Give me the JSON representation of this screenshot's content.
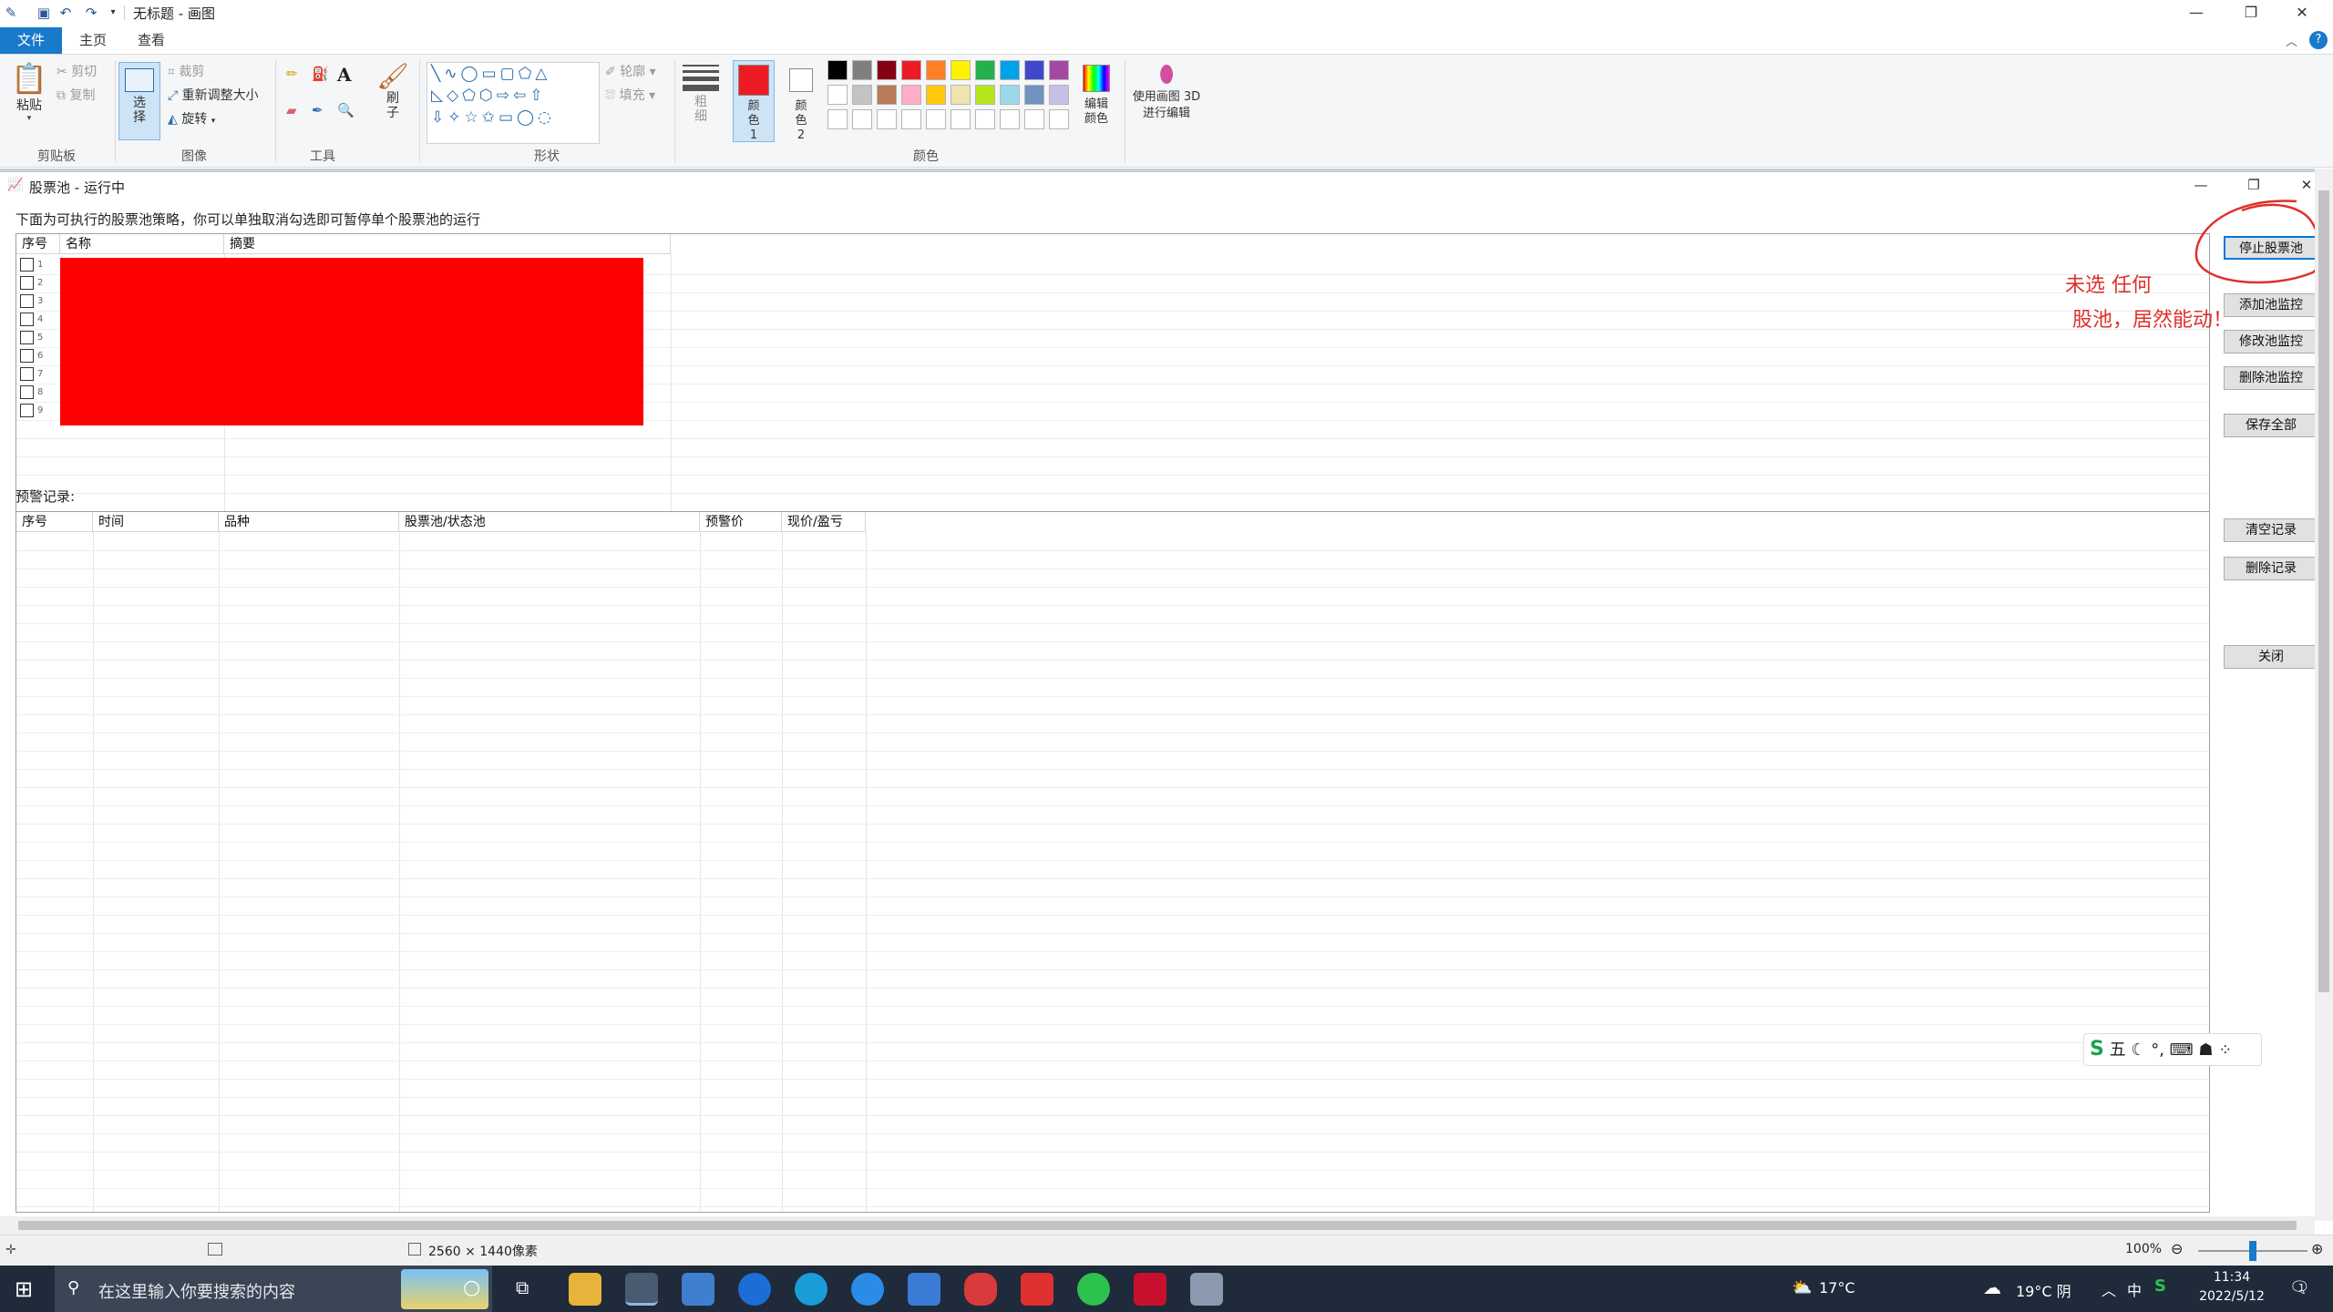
{
  "window_title": "无标题 - 画图",
  "tabs": {
    "file": "文件",
    "home": "主页",
    "view": "查看"
  },
  "ribbon": {
    "clipboard": {
      "paste": "粘贴",
      "cut": "剪切",
      "copy": "复制",
      "label": "剪贴板"
    },
    "image": {
      "select": "选择",
      "crop": "裁剪",
      "resize": "重新调整大小",
      "rotate": "旋转",
      "label": "图像"
    },
    "tools": {
      "label": "工具",
      "brush": "刷子"
    },
    "shapes": {
      "outline": "轮廓",
      "fill": "填充",
      "label": "形状"
    },
    "size": "粗细",
    "color1": "颜色 1",
    "color2": "颜色 2",
    "edit_colors": "编辑颜色",
    "paint3d": "使用画图 3D 进行编辑",
    "colors_label": "颜色",
    "palette": [
      "#000000",
      "#7f7f7f",
      "#880015",
      "#ed1c24",
      "#ff7f27",
      "#fff200",
      "#22b14c",
      "#00a2e8",
      "#3f48cc",
      "#a349a4",
      "#ffffff",
      "#c3c3c3",
      "#b97a57",
      "#ffaec9",
      "#ffc90e",
      "#efe4b0",
      "#b5e61d",
      "#99d9ea",
      "#7092be",
      "#c8bfe7"
    ],
    "color1_value": "#ed1c24",
    "color2_value": "#ffffff"
  },
  "app": {
    "title": "股票池 - 运行中",
    "description": "下面为可执行的股票池策略，你可以单独取消勾选即可暂停单个股票池的运行",
    "pool_headers": [
      "序号",
      "名称",
      "摘要"
    ],
    "pool_rows": [
      "1",
      "2",
      "3",
      "4",
      "5",
      "6",
      "7",
      "8",
      "9"
    ],
    "alert_label": "预警记录:",
    "alert_headers": [
      "序号",
      "时间",
      "品种",
      "股票池/状态池",
      "预警价",
      "现价/盈亏"
    ],
    "buttons": {
      "stop": "停止股票池",
      "add": "添加池监控",
      "modify": "修改池监控",
      "delete": "删除池监控",
      "save": "保存全部",
      "clear": "清空记录",
      "delete_record": "删除记录",
      "close": "关闭"
    },
    "annotation_line1": "未选 任何",
    "annotation_line2": "股池，居然能动！",
    "annotation_color": "#e0302a"
  },
  "status": {
    "size": "2560 × 1440像素",
    "zoom": "100%",
    "zoom_level": 0.5
  },
  "ime": {
    "mode": "五"
  },
  "taskbar": {
    "search_placeholder": "在这里输入你要搜索的内容",
    "weather_left": "17°C",
    "weather_right": "19°C 阴",
    "lang": "中",
    "time": "11:34",
    "date": "2022/5/12",
    "notif_count": "1"
  }
}
